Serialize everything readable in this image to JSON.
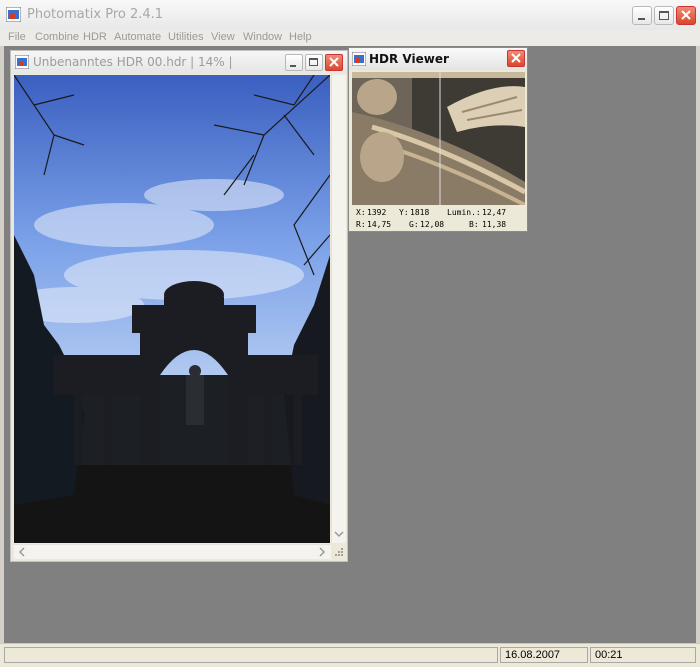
{
  "app": {
    "title": "Photomatix Pro 2.4.1"
  },
  "menu": {
    "items": [
      "File",
      "Combine",
      "HDR",
      "Automate",
      "Utilities",
      "View",
      "Window",
      "Help"
    ]
  },
  "document_window": {
    "title": "Unbenanntes HDR 00.hdr  |  14%  |"
  },
  "hdr_viewer": {
    "title": "HDR Viewer",
    "x_label": "X:",
    "x_value": "1392",
    "y_label": "Y:",
    "y_value": "1818",
    "lumin_label": "Lumin.:",
    "lumin_value": "12,47",
    "r_label": "R:",
    "r_value": "14,75",
    "g_label": "G:",
    "g_value": "12,08",
    "b_label": "B:",
    "b_value": "11,38"
  },
  "status": {
    "pane1": "",
    "date": "16.08.2007",
    "time": "00:21"
  },
  "colors": {
    "close_red": "#d9472b",
    "sky_blue": "#6a8fd8",
    "mdi_gray": "#808080",
    "stone": "#b89b7a"
  },
  "icons": [
    "photomatix-app-icon",
    "minimize-icon",
    "maximize-icon",
    "close-icon",
    "hdr-file-icon",
    "scroll-up-icon",
    "scroll-down-icon",
    "scroll-left-icon",
    "scroll-right-icon",
    "resize-grip-icon"
  ]
}
